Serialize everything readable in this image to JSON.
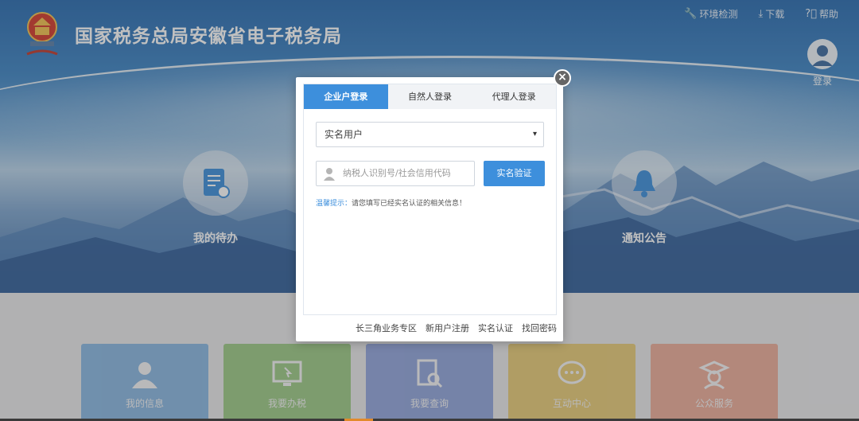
{
  "header": {
    "site_title": "国家税务总局安徽省电子税务局",
    "links": [
      {
        "icon": "wrench-icon",
        "label": "环境检测"
      },
      {
        "icon": "download-icon",
        "label": "下载"
      },
      {
        "icon": "help-icon",
        "label": "帮助"
      }
    ],
    "login_label": "登录"
  },
  "hubs": {
    "todo_label": "我的待办",
    "notice_label": "通知公告"
  },
  "tiles": [
    {
      "label": "我的信息",
      "icon": "person-icon",
      "color": "#3d8fdc"
    },
    {
      "label": "我要办税",
      "icon": "monitor-icon",
      "color": "#5fb236"
    },
    {
      "label": "我要查询",
      "icon": "document-search-icon",
      "color": "#4b6fd1"
    },
    {
      "label": "互动中心",
      "icon": "chat-icon",
      "color": "#e8b51c"
    },
    {
      "label": "公众服务",
      "icon": "service-icon",
      "color": "#ef7d58"
    }
  ],
  "modal": {
    "tabs": [
      "企业户登录",
      "自然人登录",
      "代理人登录"
    ],
    "active_tab": 0,
    "select_value": "实名用户",
    "id_placeholder": "纳税人识别号/社会信用代码",
    "verify_button": "实名验证",
    "hint_label": "温馨提示：",
    "hint_text": "请您填写已经实名认证的相关信息！",
    "footer_links": [
      "长三角业务专区",
      "新用户注册",
      "实名认证",
      "找回密码"
    ],
    "close_symbol": "×"
  },
  "colors": {
    "accent": "#3d8fdc",
    "header_blue": "#2a6cb1"
  }
}
